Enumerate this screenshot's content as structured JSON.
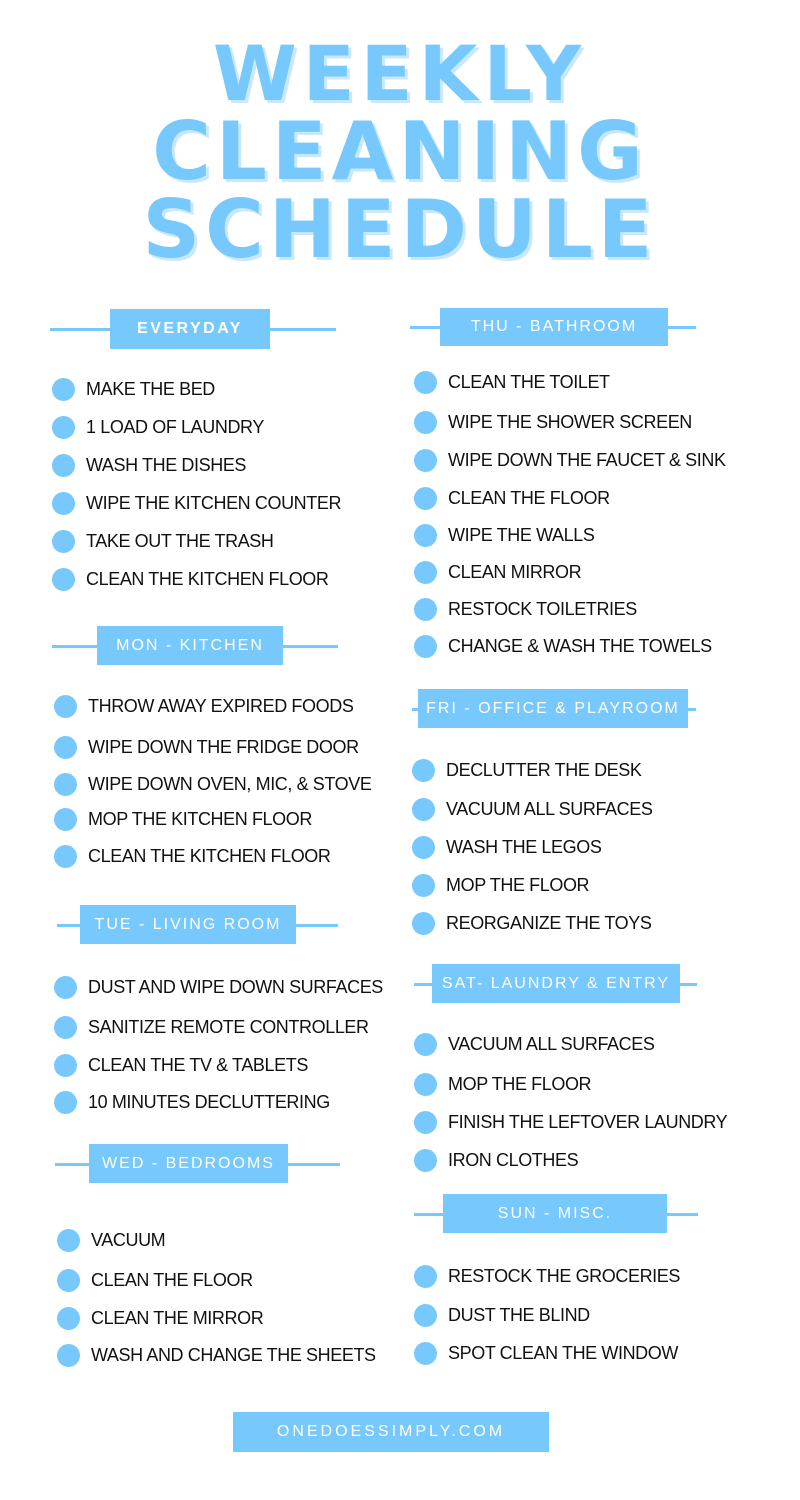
{
  "title": {
    "line1": "WEEKLY",
    "line2": "CLEANING",
    "line3": "SCHEDULE"
  },
  "accent_color": "#77c8fc",
  "sections": {
    "everyday": {
      "heading": "EVERYDAY",
      "items": [
        "MAKE THE BED",
        "1 LOAD OF LAUNDRY",
        "WASH THE DISHES",
        "WIPE THE KITCHEN COUNTER",
        "TAKE OUT THE TRASH",
        "CLEAN THE KITCHEN FLOOR"
      ]
    },
    "mon": {
      "heading": "MON - KITCHEN",
      "items": [
        " THROW AWAY EXPIRED FOODS",
        "WIPE DOWN THE FRIDGE DOOR",
        "WIPE DOWN OVEN, MIC, & STOVE",
        "MOP THE KITCHEN FLOOR",
        "CLEAN THE KITCHEN FLOOR"
      ]
    },
    "tue": {
      "heading": "TUE - LIVING ROOM",
      "items": [
        "DUST AND WIPE DOWN SURFACES",
        "SANITIZE REMOTE CONTROLLER",
        "CLEAN THE TV & TABLETS",
        "10 MINUTES DECLUTTERING"
      ]
    },
    "wed": {
      "heading": "WED - BEDROOMS",
      "items": [
        "VACUUM",
        "CLEAN THE FLOOR",
        "CLEAN THE MIRROR",
        "WASH AND CHANGE THE SHEETS"
      ]
    },
    "thu": {
      "heading": "THU - BATHROOM",
      "items": [
        "CLEAN THE TOILET",
        "WIPE THE SHOWER  SCREEN",
        "WIPE DOWN THE FAUCET & SINK",
        "CLEAN THE FLOOR",
        "WIPE THE WALLS",
        "CLEAN MIRROR",
        "RESTOCK TOILETRIES",
        "CHANGE & WASH THE TOWELS"
      ]
    },
    "fri": {
      "heading": "FRI - OFFICE & PLAYROOM",
      "items": [
        "DECLUTTER THE DESK",
        "VACUUM ALL SURFACES",
        "WASH THE LEGOS",
        "MOP THE FLOOR",
        "REORGANIZE THE TOYS"
      ]
    },
    "sat": {
      "heading": "SAT- LAUNDRY & ENTRY",
      "items": [
        "VACUUM ALL SURFACES",
        "MOP THE FLOOR",
        "FINISH THE LEFTOVER LAUNDRY",
        "IRON CLOTHES"
      ]
    },
    "sun": {
      "heading": "SUN - MISC.",
      "items": [
        "RESTOCK THE GROCERIES",
        "DUST THE BLIND",
        "SPOT CLEAN THE WINDOW"
      ]
    }
  },
  "footer": {
    "website": "ONEDOESSIMPLY.COM"
  }
}
